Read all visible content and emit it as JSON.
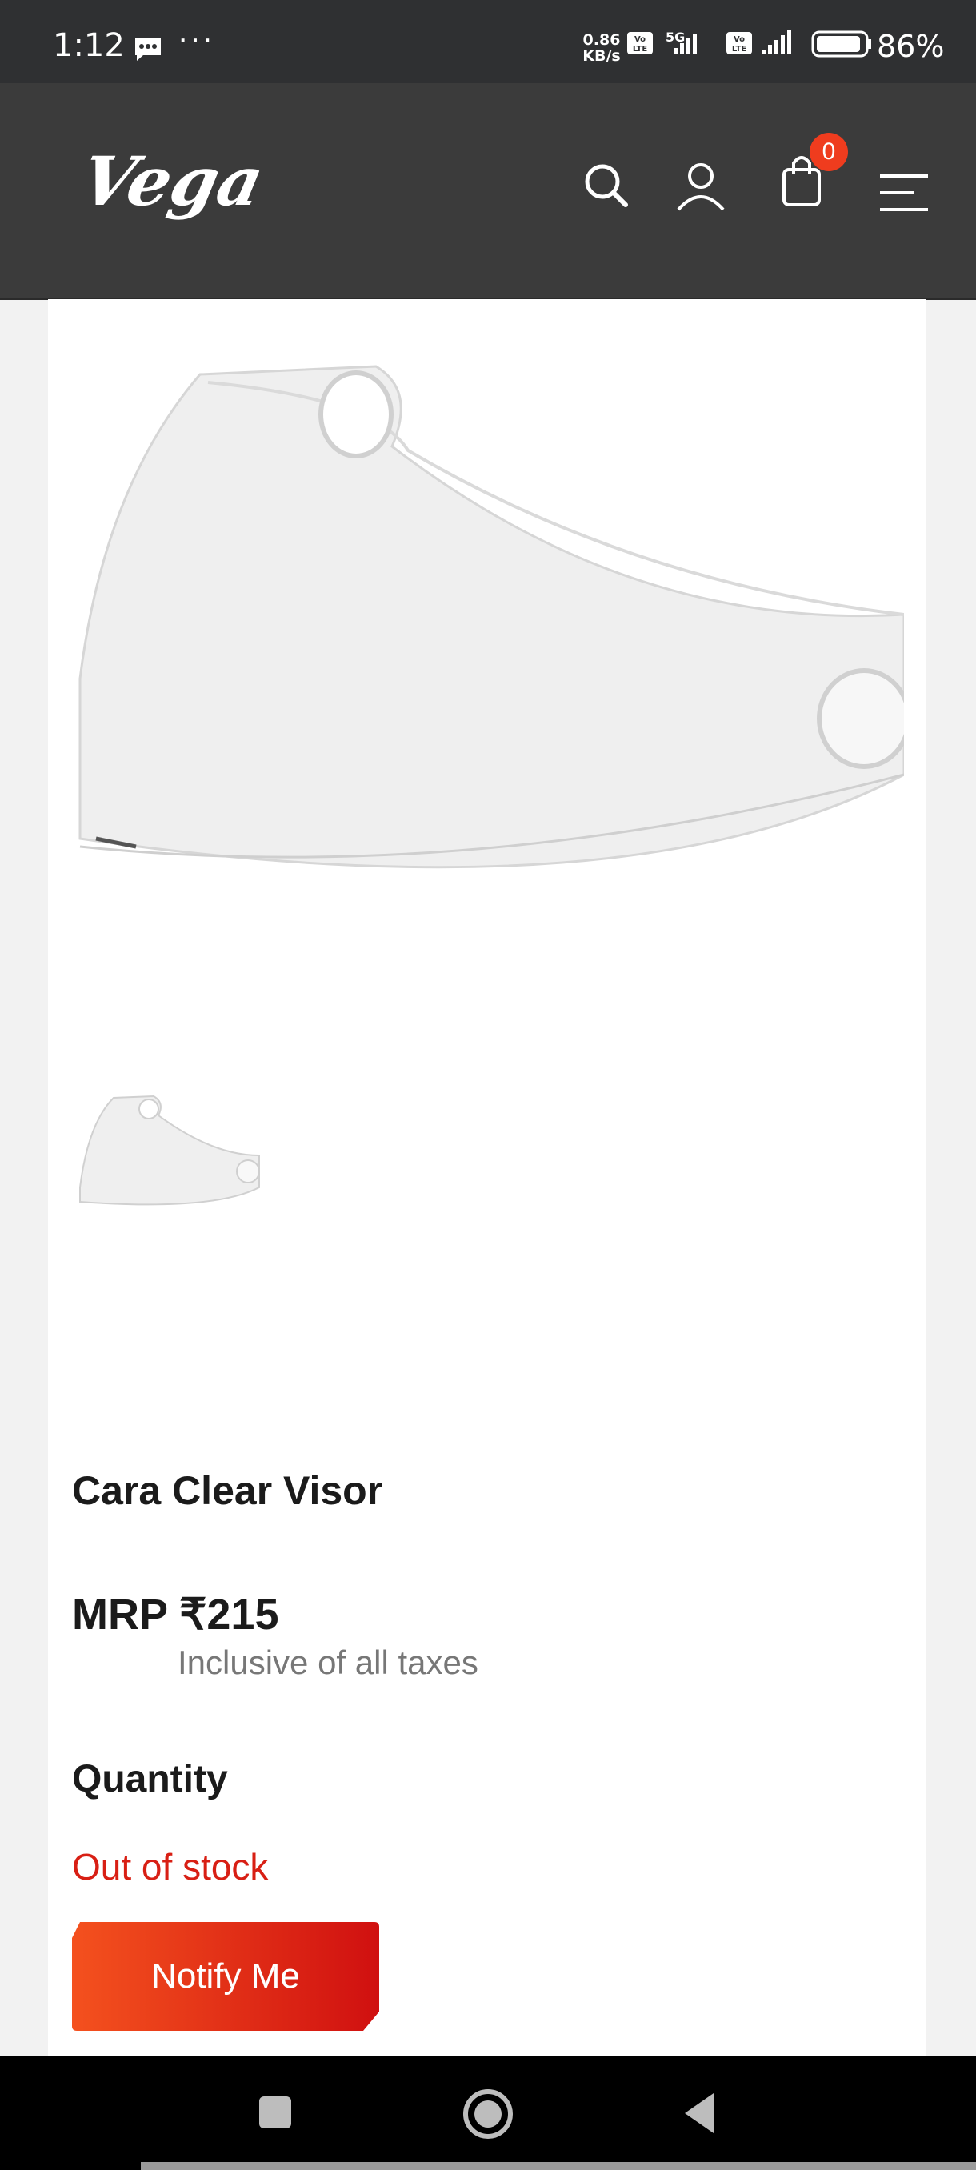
{
  "status_bar": {
    "time": "1:12",
    "dots": "···",
    "speed_top": "0.86",
    "speed_bottom": "KB/s",
    "sim1_tag": "Vo LTE",
    "network": "5G",
    "sim2_tag": "Vo LTE",
    "battery_percent": "86%"
  },
  "header": {
    "logo_text": "Vega",
    "cart_count": "0",
    "icons": [
      "search-icon",
      "account-icon",
      "cart-icon",
      "menu-icon"
    ]
  },
  "product": {
    "title": "Cara Clear Visor",
    "price": "MRP ₹215",
    "tax_note": "Inclusive of all taxes",
    "quantity_label": "Quantity",
    "stock_status": "Out of stock",
    "notify_button": "Notify Me"
  },
  "nav_bar": {
    "icons": [
      "recents-icon",
      "home-icon",
      "back-icon"
    ]
  },
  "colors": {
    "header_bg": "#3b3b3b",
    "accent_red": "#d81f14",
    "badge": "#ef3c1e"
  }
}
